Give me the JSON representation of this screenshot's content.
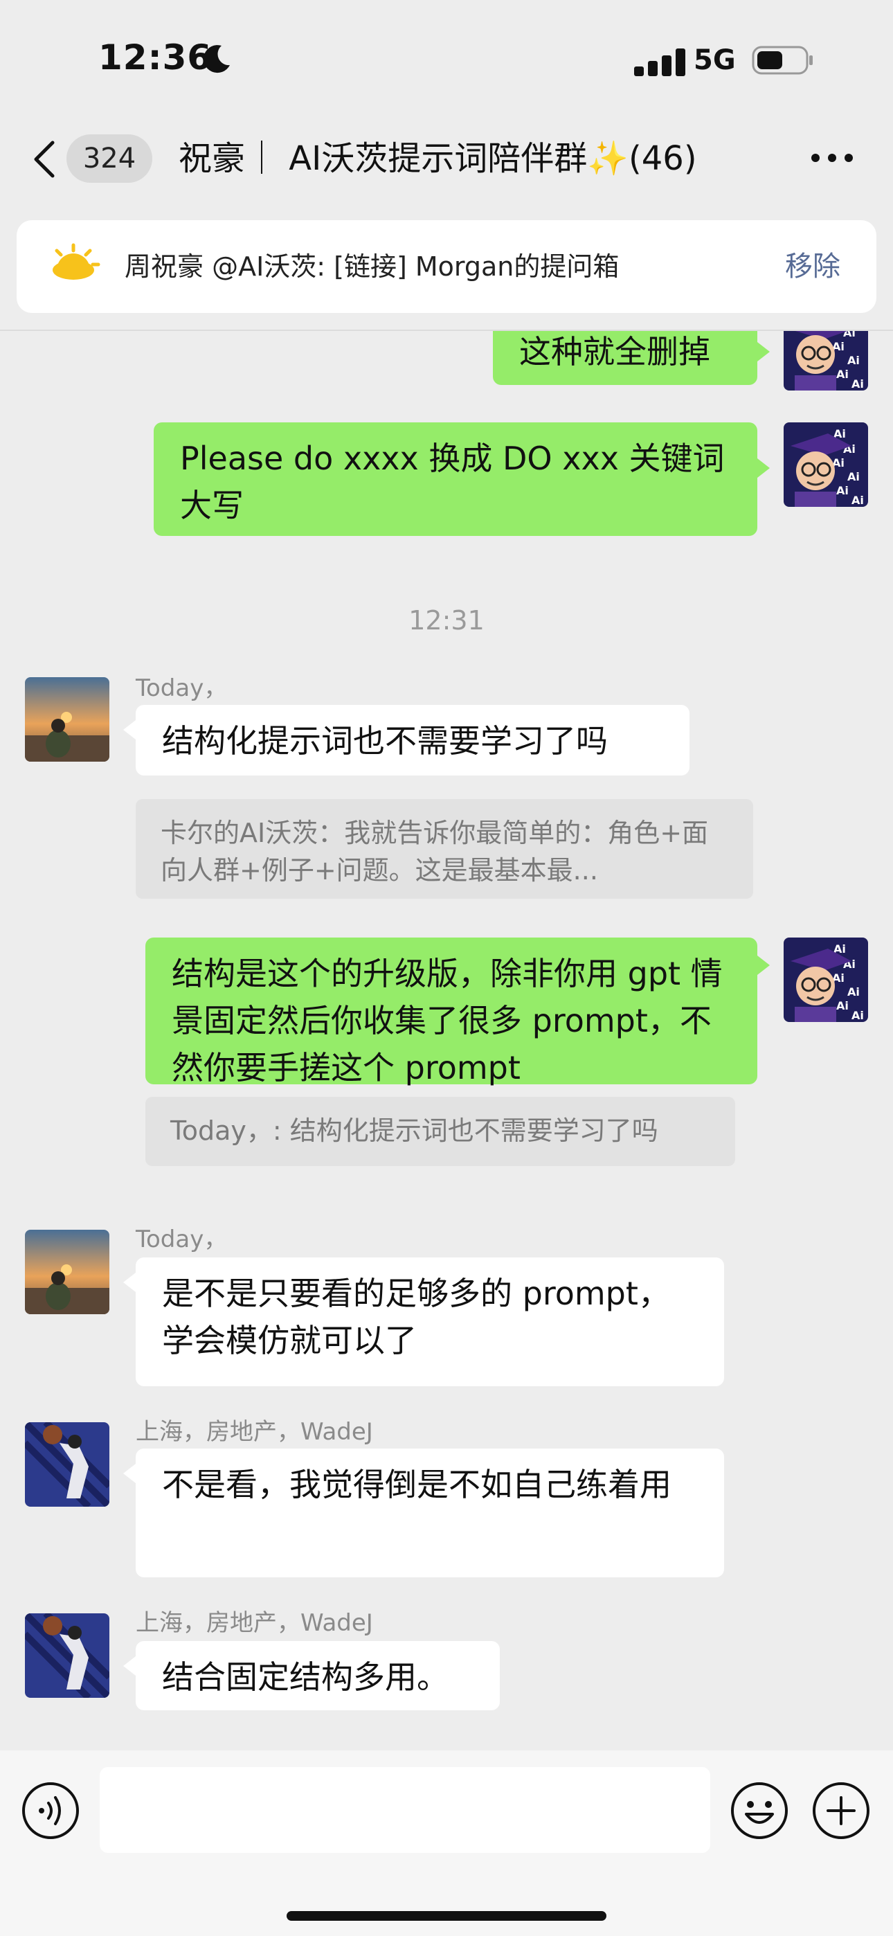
{
  "status_bar": {
    "time": "12:36",
    "network": "5G"
  },
  "nav": {
    "unread_count": "324",
    "title": "祝豪｜ AI沃茨提示词陪伴群✨(46)"
  },
  "notice": {
    "text": "周祝豪 @AI沃茨: [链接] Morgan的提问箱",
    "action": "移除"
  },
  "messages": {
    "m0": {
      "text": "这种就全删掉"
    },
    "m1": {
      "text": "Please do xxxx 换成 DO xxx 关键词大写"
    },
    "time1": "12:31",
    "m2": {
      "sender": "Today，",
      "text": "结构化提示词也不需要学习了吗",
      "quote": "卡尔的AI沃茨：我就告诉你最简单的：角色+面向人群+例子+问题。这是最基本最..."
    },
    "m3": {
      "text": "结构是这个的升级版，除非你用 gpt 情景固定然后你收集了很多 prompt，不然你要手搓这个 prompt",
      "quote": "Today，: 结构化提示词也不需要学习了吗"
    },
    "m4": {
      "sender": "Today，",
      "text": "是不是只要看的足够多的 prompt，学会模仿就可以了"
    },
    "m5": {
      "sender": "上海，房地产，WadeJ",
      "text": "不是看，我觉得倒是不如自己练着用"
    },
    "m6": {
      "sender": "上海，房地产，WadeJ",
      "text": "结合固定结构多用。"
    }
  },
  "input": {
    "value": ""
  },
  "colors": {
    "bubble_green": "#95ec69",
    "background": "#ededed",
    "link_blue": "#576b95"
  }
}
